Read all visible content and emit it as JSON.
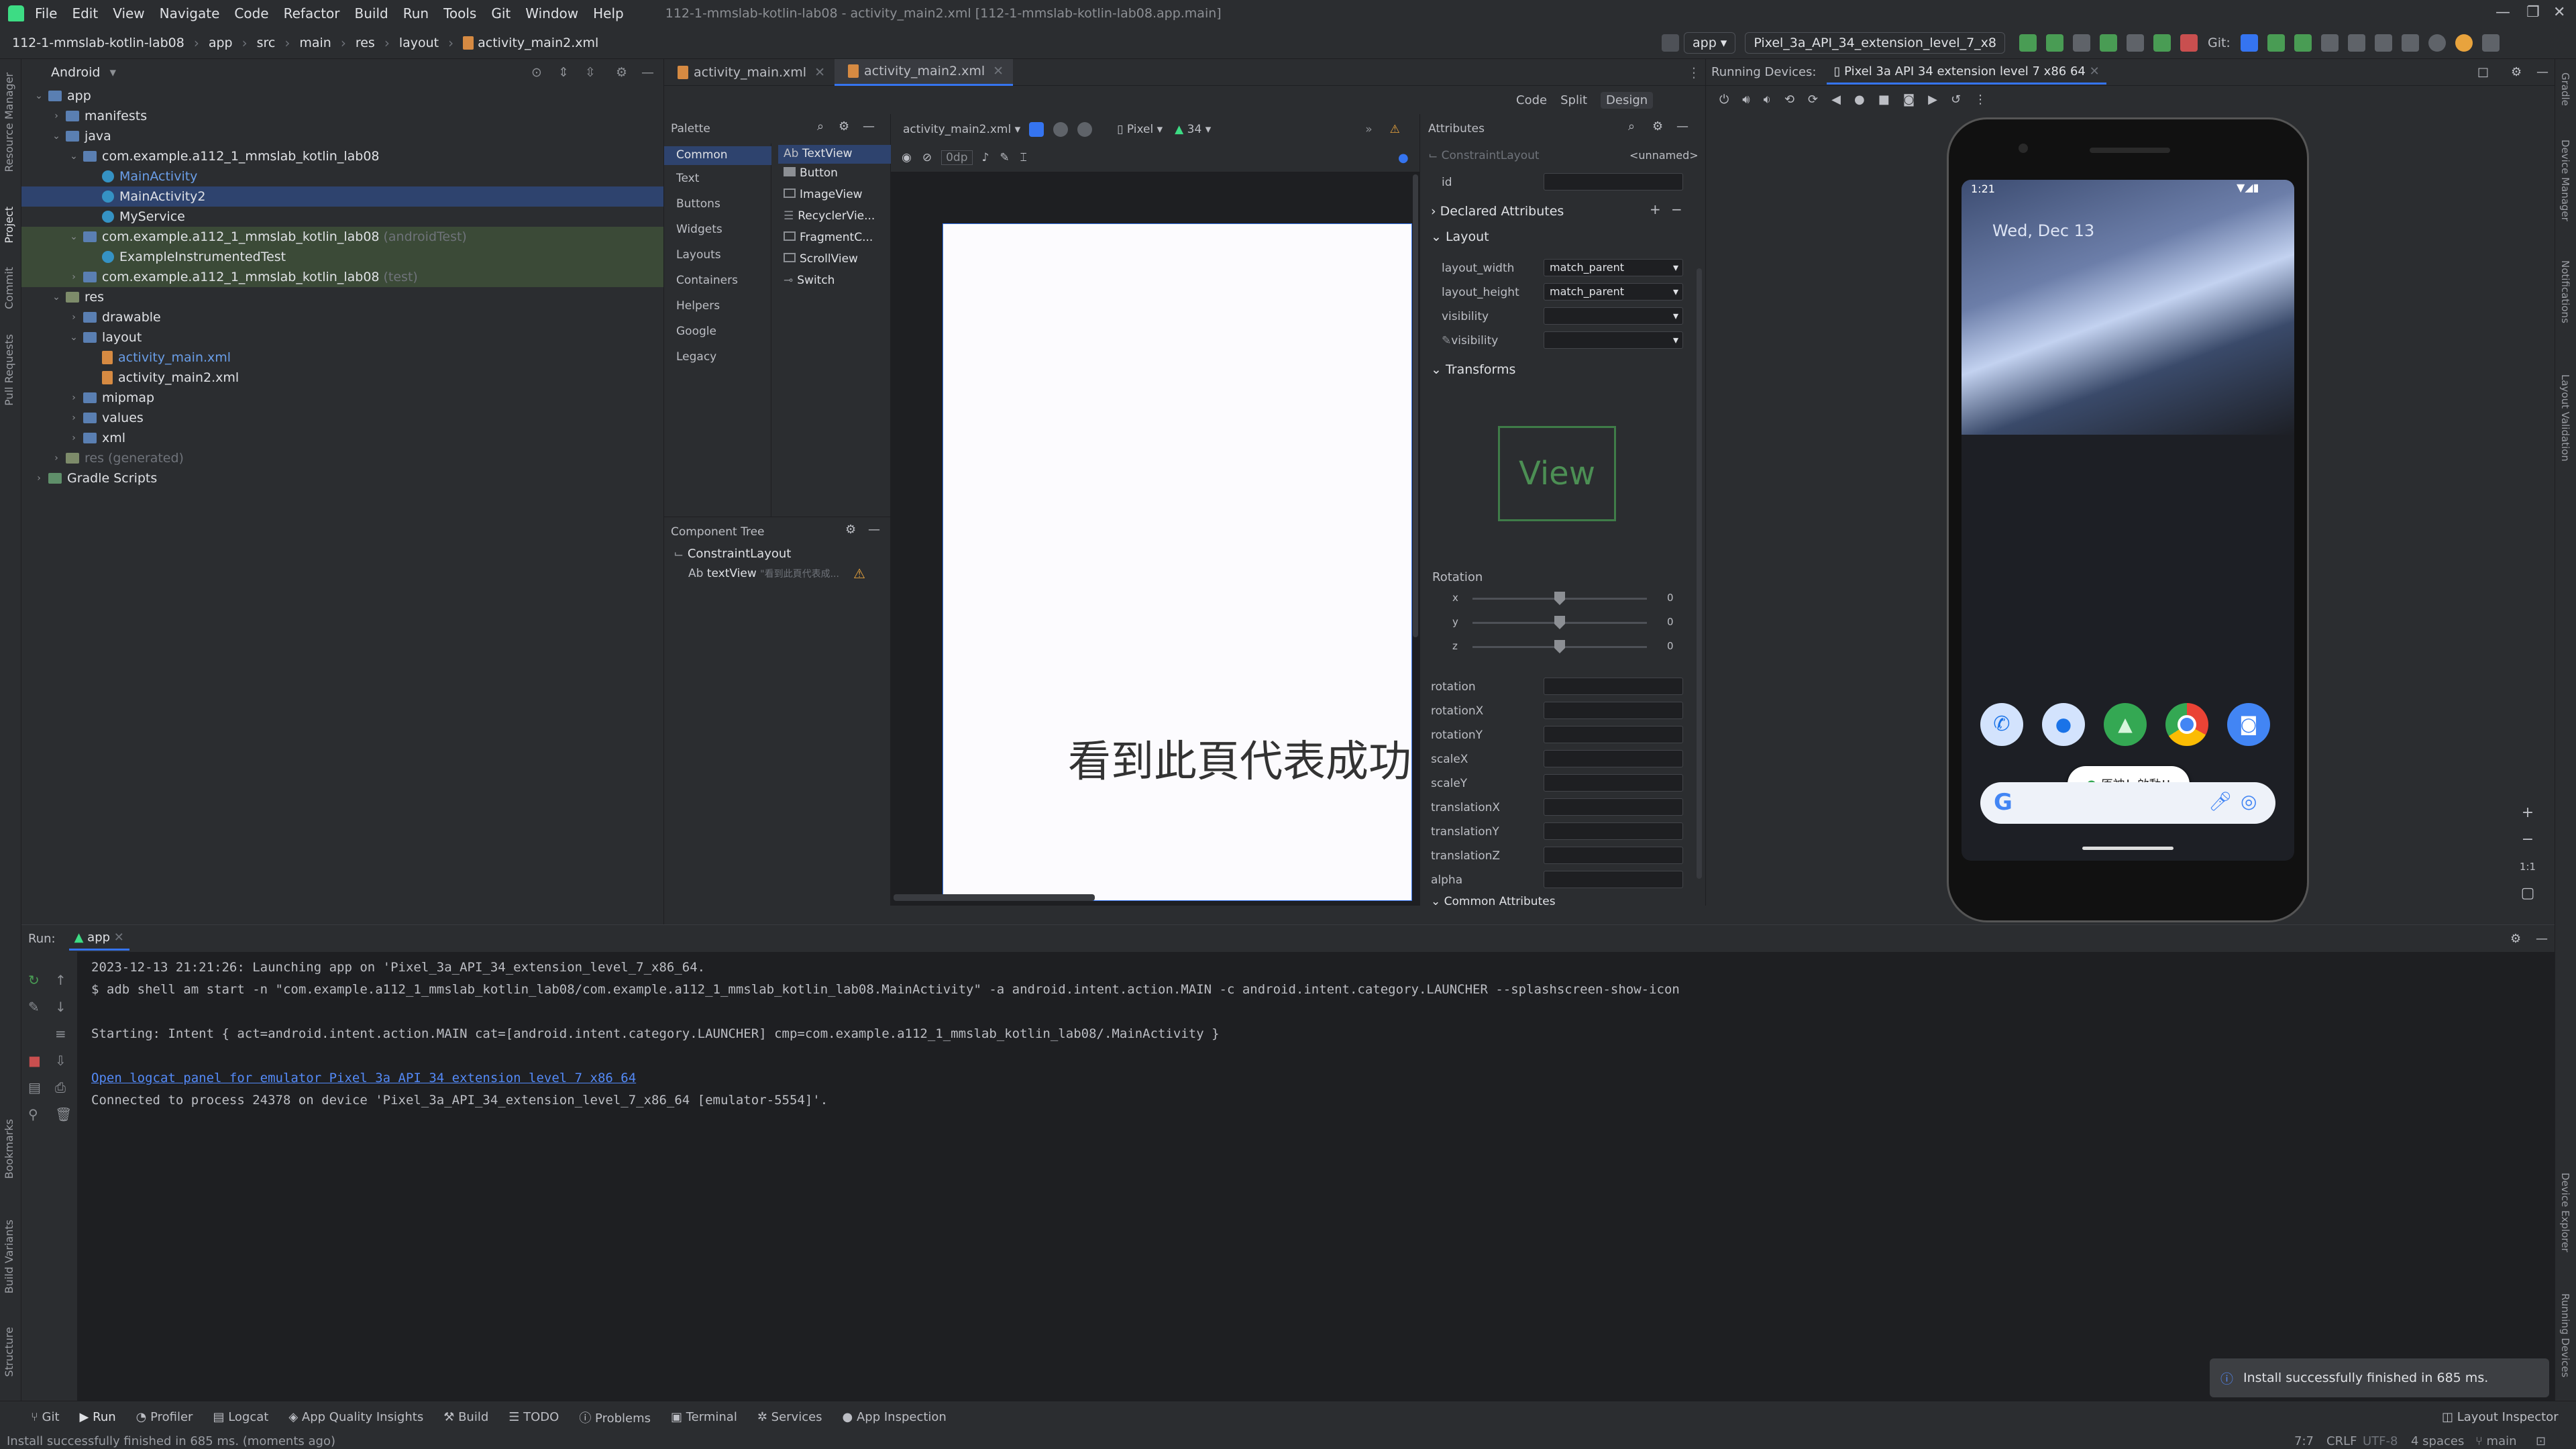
{
  "titlebar": {
    "menu": [
      "File",
      "Edit",
      "View",
      "Navigate",
      "Code",
      "Refactor",
      "Build",
      "Run",
      "Tools",
      "Git",
      "Window",
      "Help"
    ],
    "window_title": "112-1-mmslab-kotlin-lab08 - activity_main2.xml [112-1-mmslab-kotlin-lab08.app.main]"
  },
  "navbar": {
    "breadcrumbs": [
      "112-1-mmslab-kotlin-lab08",
      "app",
      "src",
      "main",
      "res",
      "layout",
      "activity_main2.xml"
    ],
    "run_config": "app",
    "device": "Pixel_3a_API_34_extension_level_7_x8",
    "git_label": "Git:"
  },
  "left_strip": [
    "Resource Manager",
    "Project",
    "Commit",
    "Pull Requests",
    "Bookmarks",
    "Build Variants",
    "Structure"
  ],
  "right_strip": [
    "Gradle",
    "Device Manager",
    "Notifications",
    "Layout Validation",
    "Device Explorer",
    "Running Devices"
  ],
  "project": {
    "view_mode": "Android",
    "tree": [
      {
        "label": "app",
        "suffix": "",
        "depth": 0,
        "kind": "folder",
        "open": true
      },
      {
        "label": "manifests",
        "suffix": "",
        "depth": 1,
        "kind": "folder",
        "open": false
      },
      {
        "label": "java",
        "suffix": "",
        "depth": 1,
        "kind": "folder",
        "open": true
      },
      {
        "label": "com.example.a112_1_mmslab_kotlin_lab08",
        "suffix": "",
        "depth": 2,
        "kind": "folder",
        "open": true
      },
      {
        "label": "MainActivity",
        "suffix": "",
        "depth": 3,
        "kind": "class",
        "style": "blue"
      },
      {
        "label": "MainActivity2",
        "suffix": "",
        "depth": 3,
        "kind": "class",
        "style": "sel"
      },
      {
        "label": "MyService",
        "suffix": "",
        "depth": 3,
        "kind": "class"
      },
      {
        "label": "com.example.a112_1_mmslab_kotlin_lab08",
        "suffix": "(androidTest)",
        "depth": 2,
        "kind": "folder",
        "open": true,
        "style": "test"
      },
      {
        "label": "ExampleInstrumentedTest",
        "suffix": "",
        "depth": 3,
        "kind": "class",
        "style": "test"
      },
      {
        "label": "com.example.a112_1_mmslab_kotlin_lab08",
        "suffix": "(test)",
        "depth": 2,
        "kind": "folder",
        "open": false,
        "style": "test"
      },
      {
        "label": "res",
        "suffix": "",
        "depth": 1,
        "kind": "res",
        "open": true
      },
      {
        "label": "drawable",
        "suffix": "",
        "depth": 2,
        "kind": "folder",
        "open": false
      },
      {
        "label": "layout",
        "suffix": "",
        "depth": 2,
        "kind": "folder",
        "open": true
      },
      {
        "label": "activity_main.xml",
        "suffix": "",
        "depth": 3,
        "kind": "file",
        "style": "blue"
      },
      {
        "label": "activity_main2.xml",
        "suffix": "",
        "depth": 3,
        "kind": "file"
      },
      {
        "label": "mipmap",
        "suffix": "",
        "depth": 2,
        "kind": "folder",
        "open": false
      },
      {
        "label": "values",
        "suffix": "",
        "depth": 2,
        "kind": "folder",
        "open": false
      },
      {
        "label": "xml",
        "suffix": "",
        "depth": 2,
        "kind": "folder",
        "open": false
      },
      {
        "label": "res",
        "suffix": "(generated)",
        "depth": 1,
        "kind": "res",
        "style": "grey"
      },
      {
        "label": "Gradle Scripts",
        "suffix": "",
        "depth": 0,
        "kind": "gradle",
        "open": false
      }
    ]
  },
  "editor_tabs": [
    {
      "label": "activity_main.xml",
      "active": false
    },
    {
      "label": "activity_main2.xml",
      "active": true
    }
  ],
  "view_modes": [
    "Code",
    "Split",
    "Design"
  ],
  "palette": {
    "title": "Palette",
    "categories": [
      "Common",
      "Text",
      "Buttons",
      "Widgets",
      "Layouts",
      "Containers",
      "Helpers",
      "Google",
      "Legacy"
    ],
    "items": [
      "TextView",
      "Button",
      "ImageView",
      "RecyclerVie...",
      "FragmentC...",
      "ScrollView",
      "Switch"
    ]
  },
  "component_tree": {
    "title": "Component Tree",
    "root": "ConstraintLayout",
    "child": "textView",
    "child_hint": "\"看到此頁代表成..."
  },
  "design_toolbar": {
    "file": "activity_main2.xml",
    "margin": "0dp",
    "device": "Pixel",
    "api": "34"
  },
  "device_preview": {
    "text": "看到此頁代表成功"
  },
  "attributes": {
    "title": "Attributes",
    "component": "ConstraintLayout",
    "component_id_value": "<unnamed>",
    "id_label": "id",
    "sections": [
      "Declared Attributes",
      "Layout",
      "Transforms",
      "Common Attributes"
    ],
    "layout_fields": [
      {
        "label": "layout_width",
        "value": "match_parent"
      },
      {
        "label": "layout_height",
        "value": "match_parent"
      },
      {
        "label": "visibility",
        "value": ""
      },
      {
        "label": "visibility",
        "value": ""
      }
    ],
    "view_box_label": "View",
    "rotation_label": "Rotation",
    "rotation_axes": [
      {
        "axis": "x",
        "value": "0"
      },
      {
        "axis": "y",
        "value": "0"
      },
      {
        "axis": "z",
        "value": "0"
      }
    ],
    "transform_fields": [
      "rotation",
      "rotationX",
      "rotationY",
      "scaleX",
      "scaleY",
      "translationX",
      "translationY",
      "translationZ",
      "alpha"
    ]
  },
  "running_devices": {
    "title": "Running Devices:",
    "device_tab": "Pixel 3a API 34 extension level 7 x86 64",
    "phone": {
      "time": "1:21",
      "date": "Wed, Dec 13",
      "notification": "原神！啟動!!"
    }
  },
  "run_panel": {
    "label": "Run:",
    "tab": "app",
    "lines": [
      "2023-12-13 21:21:26: Launching app on 'Pixel_3a_API_34_extension_level_7_x86_64.",
      "$ adb shell am start -n \"com.example.a112_1_mmslab_kotlin_lab08/com.example.a112_1_mmslab_kotlin_lab08.MainActivity\" -a android.intent.action.MAIN -c android.intent.category.LAUNCHER --splashscreen-show-icon",
      "",
      "Starting: Intent { act=android.intent.action.MAIN cat=[android.intent.category.LAUNCHER] cmp=com.example.a112_1_mmslab_kotlin_lab08/.MainActivity }",
      "",
      "Open logcat panel for emulator Pixel 3a API 34 extension level 7 x86 64",
      "Connected to process 24378 on device 'Pixel_3a_API_34_extension_level_7_x86_64 [emulator-5554]'."
    ]
  },
  "toast": "Install successfully finished in 685 ms.",
  "bottom_tools": [
    "Git",
    "Run",
    "Profiler",
    "Logcat",
    "App Quality Insights",
    "Build",
    "TODO",
    "Problems",
    "Terminal",
    "Services",
    "App Inspection"
  ],
  "layout_inspector": "Layout Inspector",
  "status": {
    "message": "Install successfully finished in 685 ms. (moments ago)",
    "position": "7:7",
    "line_sep": "CRLF",
    "encoding": "UTF-8",
    "indent": "4 spaces",
    "branch": "main"
  },
  "colors": {
    "accent": "#3574f0",
    "android_green": "#3ddc84",
    "selection": "#2e436e"
  }
}
